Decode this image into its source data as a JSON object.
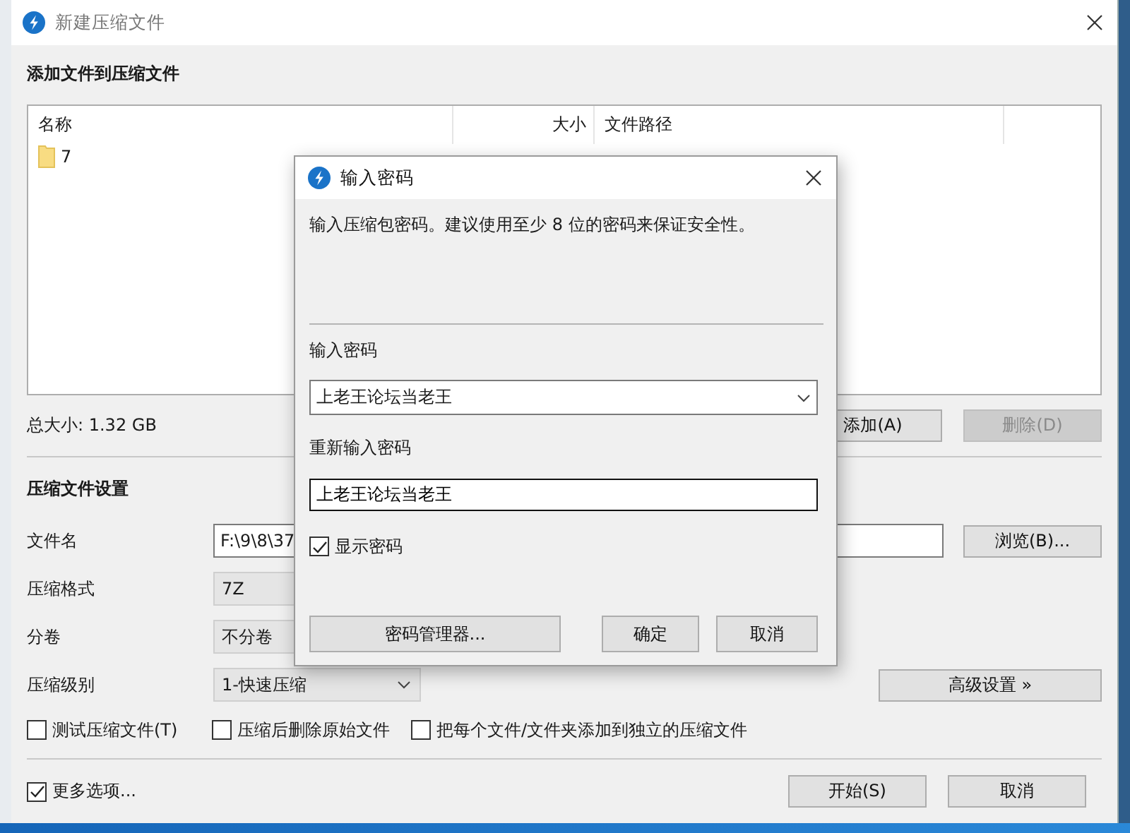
{
  "window": {
    "title": "新建压缩文件"
  },
  "files_section": {
    "heading": "添加文件到压缩文件",
    "columns": [
      "名称",
      "大小",
      "文件路径"
    ],
    "rows": [
      {
        "name": "7"
      }
    ],
    "total": "总大小: 1.32 GB",
    "buttons": [
      {
        "label": "添加(A)",
        "disabled": false
      },
      {
        "label": "删除(D)",
        "disabled": true
      }
    ]
  },
  "settings": {
    "heading": "压缩文件设置",
    "fields": [
      {
        "kind": "input",
        "label": "文件名",
        "value": "F:\\9\\8\\37"
      },
      {
        "kind": "select",
        "label": "压缩格式",
        "value": "7Z"
      },
      {
        "kind": "select",
        "label": "分卷",
        "value": "不分卷"
      },
      {
        "kind": "select",
        "label": "压缩级别",
        "value": "1-快速压缩"
      }
    ],
    "browse_button": "浏览(B)...",
    "advanced_button": "高级设置 »",
    "options": [
      {
        "label": "测试压缩文件(T)",
        "checked": false
      },
      {
        "label": "压缩后删除原始文件",
        "checked": false
      },
      {
        "label": "把每个文件/文件夹添加到独立的压缩文件",
        "checked": false
      }
    ]
  },
  "footer": {
    "more_options": {
      "label": "更多选项...",
      "checked": true
    },
    "buttons": [
      "开始(S)",
      "取消"
    ]
  },
  "password_dialog": {
    "title": "输入密码",
    "hint": "输入压缩包密码。建议使用至少 8 位的密码来保证安全性。",
    "password_label": "输入密码",
    "password": "上老王论坛当老王",
    "confirm_label": "重新输入密码",
    "confirm": "上老王论坛当老王",
    "show_password": {
      "label": "显示密码",
      "checked": true
    },
    "buttons": [
      "密码管理器...",
      "确定",
      "取消"
    ]
  }
}
